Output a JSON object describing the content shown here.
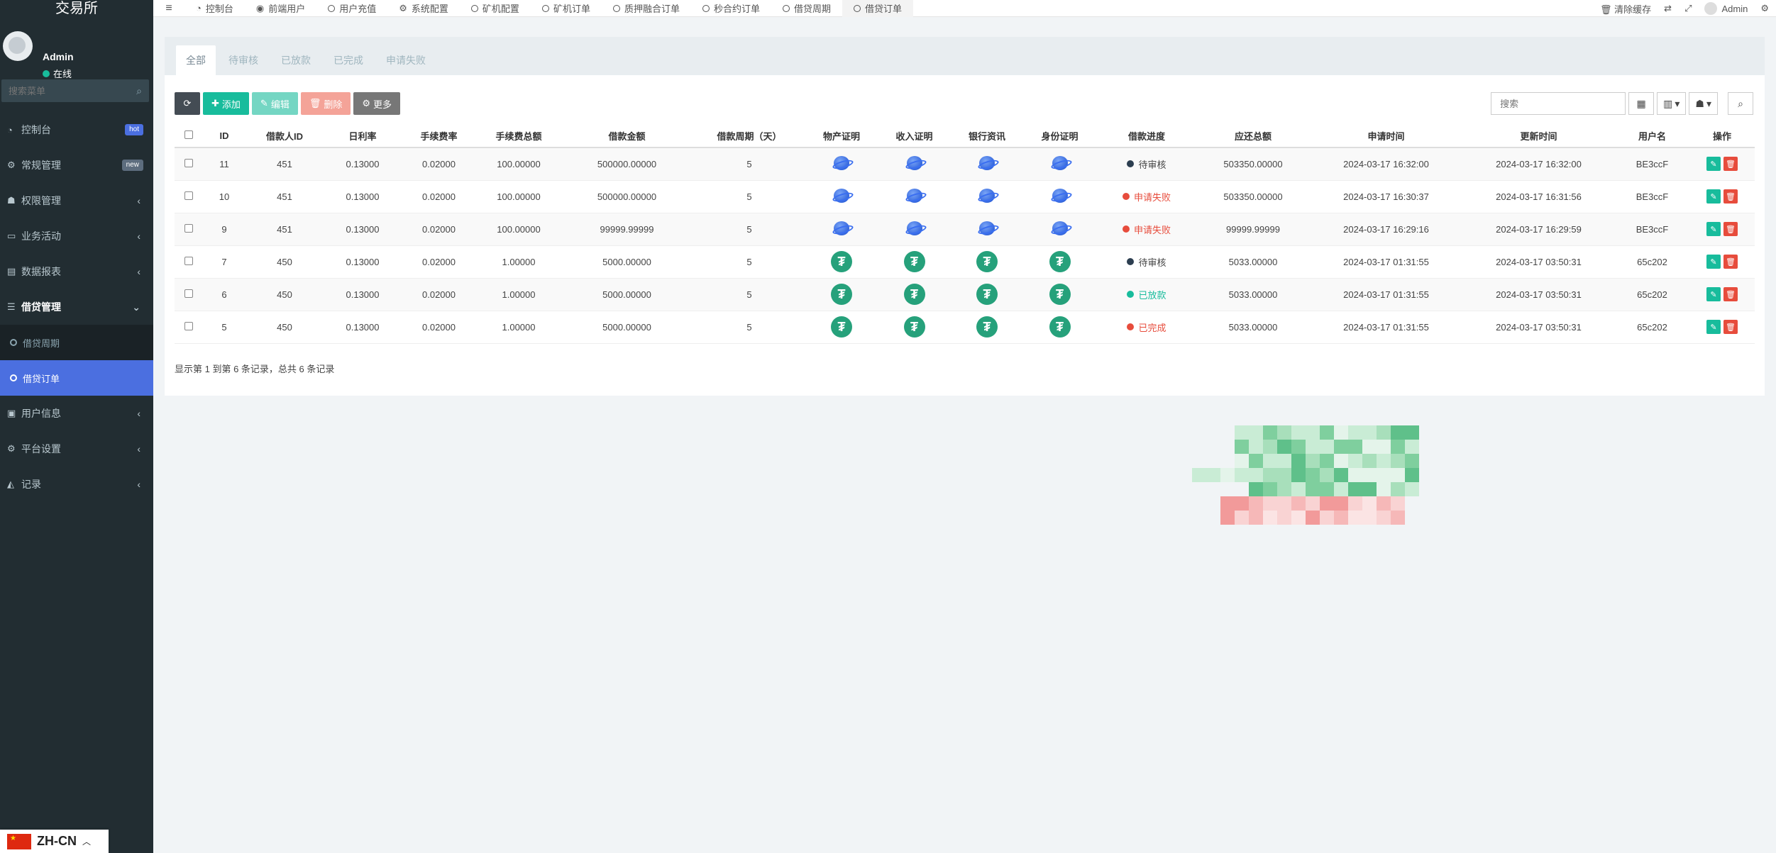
{
  "app": {
    "title": "交易所"
  },
  "user": {
    "name": "Admin",
    "status": "在线"
  },
  "sidebar": {
    "search_placeholder": "搜索菜单",
    "items": [
      {
        "label": "控制台",
        "icon": "dashboard-icon",
        "badge": "hot"
      },
      {
        "label": "常规管理",
        "icon": "cogs-icon",
        "badge": "new"
      },
      {
        "label": "权限管理",
        "icon": "users-icon"
      },
      {
        "label": "业务活动",
        "icon": "card-icon"
      },
      {
        "label": "数据报表",
        "icon": "report-icon"
      },
      {
        "label": "借贷管理",
        "icon": "list-icon"
      },
      {
        "label": "用户信息",
        "icon": "id-icon"
      },
      {
        "label": "平台设置",
        "icon": "gear-icon"
      },
      {
        "label": "记录",
        "icon": "chart-icon"
      }
    ],
    "sub_items": [
      {
        "label": "借贷周期"
      },
      {
        "label": "借贷订单"
      }
    ]
  },
  "lang": {
    "label": "ZH-CN"
  },
  "topnav": {
    "tabs": [
      {
        "label": "控制台"
      },
      {
        "label": "前端用户"
      },
      {
        "label": "用户充值"
      },
      {
        "label": "系统配置"
      },
      {
        "label": "矿机配置"
      },
      {
        "label": "矿机订单"
      },
      {
        "label": "质押融合订单"
      },
      {
        "label": "秒合约订单"
      },
      {
        "label": "借贷周期"
      },
      {
        "label": "借贷订单"
      }
    ],
    "clear_cache": "清除缓存",
    "admin": "Admin"
  },
  "panel": {
    "tabs": [
      {
        "label": "全部"
      },
      {
        "label": "待审核"
      },
      {
        "label": "已放款"
      },
      {
        "label": "已完成"
      },
      {
        "label": "申请失败"
      }
    ],
    "toolbar": {
      "add": "添加",
      "edit": "编辑",
      "delete": "删除",
      "more": "更多"
    },
    "search_placeholder": "搜索",
    "footer": "显示第 1 到第 6 条记录，总共 6 条记录"
  },
  "table": {
    "headers": [
      "ID",
      "借款人ID",
      "日利率",
      "手续费率",
      "手续费总额",
      "借款金额",
      "借款周期（天）",
      "物产证明",
      "收入证明",
      "银行资讯",
      "身份证明",
      "借款进度",
      "应还总额",
      "申请时间",
      "更新时间",
      "用户名",
      "操作"
    ],
    "rows": [
      {
        "id": "11",
        "uid": "451",
        "rate": "0.13000",
        "fee_rate": "0.02000",
        "fee_total": "100.00000",
        "amount": "500000.00000",
        "days": "5",
        "proof": "globe",
        "status": "待审核",
        "status_color": "#2c3e50",
        "repay": "503350.00000",
        "created": "2024-03-17 16:32:00",
        "updated": "2024-03-17 16:32:00",
        "username": "BE3ccF"
      },
      {
        "id": "10",
        "uid": "451",
        "rate": "0.13000",
        "fee_rate": "0.02000",
        "fee_total": "100.00000",
        "amount": "500000.00000",
        "days": "5",
        "proof": "globe",
        "status": "申请失败",
        "status_color": "#e74c3c",
        "repay": "503350.00000",
        "created": "2024-03-17 16:30:37",
        "updated": "2024-03-17 16:31:56",
        "username": "BE3ccF"
      },
      {
        "id": "9",
        "uid": "451",
        "rate": "0.13000",
        "fee_rate": "0.02000",
        "fee_total": "100.00000",
        "amount": "99999.99999",
        "days": "5",
        "proof": "globe",
        "status": "申请失败",
        "status_color": "#e74c3c",
        "repay": "99999.99999",
        "created": "2024-03-17 16:29:16",
        "updated": "2024-03-17 16:29:59",
        "username": "BE3ccF"
      },
      {
        "id": "7",
        "uid": "450",
        "rate": "0.13000",
        "fee_rate": "0.02000",
        "fee_total": "1.00000",
        "amount": "5000.00000",
        "days": "5",
        "proof": "tether",
        "status": "待审核",
        "status_color": "#2c3e50",
        "repay": "5033.00000",
        "created": "2024-03-17 01:31:55",
        "updated": "2024-03-17 03:50:31",
        "username": "65c202"
      },
      {
        "id": "6",
        "uid": "450",
        "rate": "0.13000",
        "fee_rate": "0.02000",
        "fee_total": "1.00000",
        "amount": "5000.00000",
        "days": "5",
        "proof": "tether",
        "status": "已放款",
        "status_color": "#18bc9c",
        "repay": "5033.00000",
        "created": "2024-03-17 01:31:55",
        "updated": "2024-03-17 03:50:31",
        "username": "65c202"
      },
      {
        "id": "5",
        "uid": "450",
        "rate": "0.13000",
        "fee_rate": "0.02000",
        "fee_total": "1.00000",
        "amount": "5000.00000",
        "days": "5",
        "proof": "tether",
        "status": "已完成",
        "status_color": "#e74c3c",
        "repay": "5033.00000",
        "created": "2024-03-17 01:31:55",
        "updated": "2024-03-17 03:50:31",
        "username": "65c202"
      }
    ]
  }
}
